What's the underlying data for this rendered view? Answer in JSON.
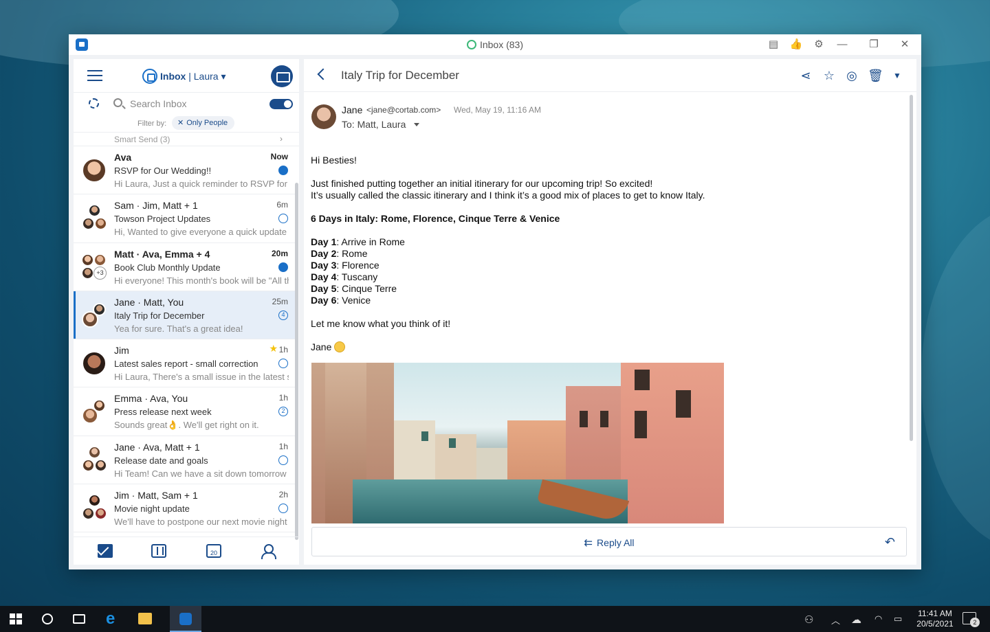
{
  "window": {
    "title": "Inbox (83)"
  },
  "sidebar": {
    "account_folder": "Inbox",
    "account_name": "Laura",
    "search_placeholder": "Search Inbox",
    "filter_label": "Filter by:",
    "filter_chip": "Only People",
    "smart_send": "Smart Send (3)",
    "nav": {
      "calendar_day": "20"
    }
  },
  "threads": [
    {
      "sender": "Ava",
      "time": "Now",
      "subject": "RSVP for Our Wedding!!",
      "preview": "Hi Laura, Just a quick reminder to RSVP for our wedding",
      "unread": true,
      "status": "unread"
    },
    {
      "sender": "Sam · Jim, Matt + 1",
      "time": "6m",
      "subject": "Towson Project Updates",
      "preview": "Hi, Wanted to give everyone a quick update",
      "unread": false,
      "status": "read"
    },
    {
      "sender": "Matt · Ava, Emma + 4",
      "time": "20m",
      "subject": "Book Club Monthly Update",
      "preview": "Hi everyone! This month's book will be \"All the",
      "unread": true,
      "status": "unread",
      "extra_count": "+3"
    },
    {
      "sender": "Jane · Matt, You",
      "time": "25m",
      "subject": "Italy Trip for December",
      "preview": "Yea for sure. That's a great idea!",
      "unread": false,
      "status": "count",
      "count": "4",
      "selected": true
    },
    {
      "sender": "Jim",
      "time": "1h",
      "subject": "Latest sales report - small correction",
      "preview": "Hi Laura, There's a small issue in the latest sales",
      "unread": false,
      "status": "read",
      "starred": true
    },
    {
      "sender": "Emma · Ava, You",
      "time": "1h",
      "subject": "Press release next week",
      "preview": "Sounds great👌. We'll get right on it.",
      "unread": false,
      "status": "count",
      "count": "2"
    },
    {
      "sender": "Jane · Ava, Matt + 1",
      "time": "1h",
      "subject": "Release date and goals",
      "preview": "Hi Team! Can we have a sit down tomorrow regarding",
      "unread": false,
      "status": "read"
    },
    {
      "sender": "Jim · Matt, Sam + 1",
      "time": "2h",
      "subject": "Movie night update",
      "preview": "We'll have to postpone our next movie night",
      "unread": false,
      "status": "read"
    }
  ],
  "message": {
    "subject": "Italy Trip for December",
    "from_name": "Jane",
    "from_email": "<jane@cortab.com>",
    "date": "Wed, May 19, 11:16 AM",
    "to": "To: Matt, Laura",
    "greeting": "Hi Besties!",
    "para1_line1": "Just finished putting together an initial itinerary for our upcoming trip! So excited!",
    "para1_line2": "It’s usually called the classic itinerary and I think it’s a good mix of places to get to know Italy.",
    "heading": "6 Days in Italy: Rome, Florence, Cinque Terre & Venice",
    "days": [
      {
        "label": "Day 1",
        "place": ": Arrive in Rome"
      },
      {
        "label": "Day 2",
        "place": ": Rome"
      },
      {
        "label": "Day 3",
        "place": ": Florence"
      },
      {
        "label": "Day 4",
        "place": ": Tuscany"
      },
      {
        "label": "Day 5",
        "place": ": Cinque Terre"
      },
      {
        "label": "Day 6",
        "place": ": Venice"
      }
    ],
    "closing": "Let me know what you think of it!",
    "signature": "Jane",
    "image_subject": "venice-canal-photo",
    "reply_all_label": "Reply All"
  },
  "taskbar": {
    "time": "11:41 AM",
    "date": "20/5/2021",
    "notification_count": "2"
  },
  "colors": {
    "accent": "#1a4b8a",
    "link": "#1a6fc7",
    "selected_bg": "#e6eef8"
  }
}
